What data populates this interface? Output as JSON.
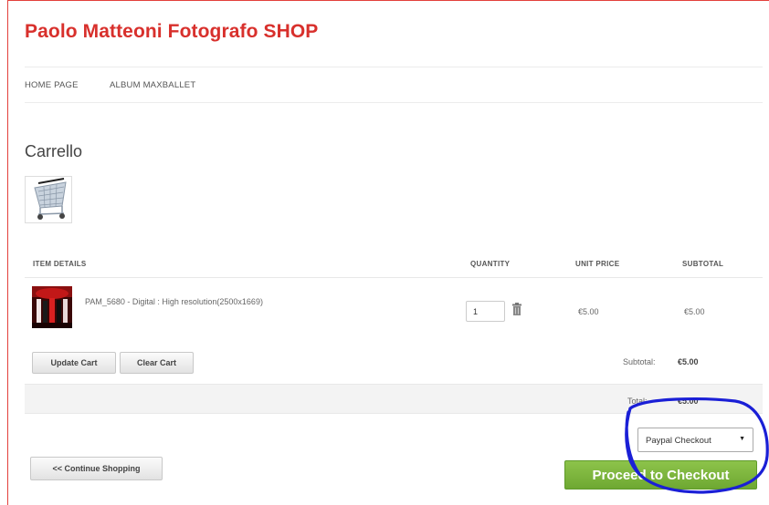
{
  "site": {
    "title": "Paolo Matteoni Fotografo SHOP"
  },
  "nav": {
    "items": [
      {
        "label": "HOME PAGE"
      },
      {
        "label": "ALBUM MAXBALLET"
      }
    ]
  },
  "page": {
    "heading": "Carrello",
    "cart_icon": "shopping-cart-icon"
  },
  "table": {
    "headers": {
      "item_details": "ITEM DETAILS",
      "quantity": "QUANTITY",
      "unit_price": "UNIT PRICE",
      "subtotal": "SUBTOTAL"
    },
    "rows": [
      {
        "name": "PAM_5680 - Digital : High resolution(2500x1669)",
        "quantity": "1",
        "unit_price": "€5.00",
        "subtotal": "€5.00"
      }
    ]
  },
  "actions": {
    "update_cart": "Update Cart",
    "clear_cart": "Clear Cart",
    "continue_shopping": "<< Continue Shopping",
    "proceed": "Proceed to Checkout"
  },
  "totals": {
    "subtotal_label": "Subtotal:",
    "subtotal_value": "€5.00",
    "total_label": "Total:",
    "total_value": "€5.00"
  },
  "checkout": {
    "method_selected": "Paypal Checkout"
  },
  "colors": {
    "brand_red": "#d8302c",
    "checkout_green": "#7bb53c",
    "annotation_blue": "#1a1fd6"
  }
}
